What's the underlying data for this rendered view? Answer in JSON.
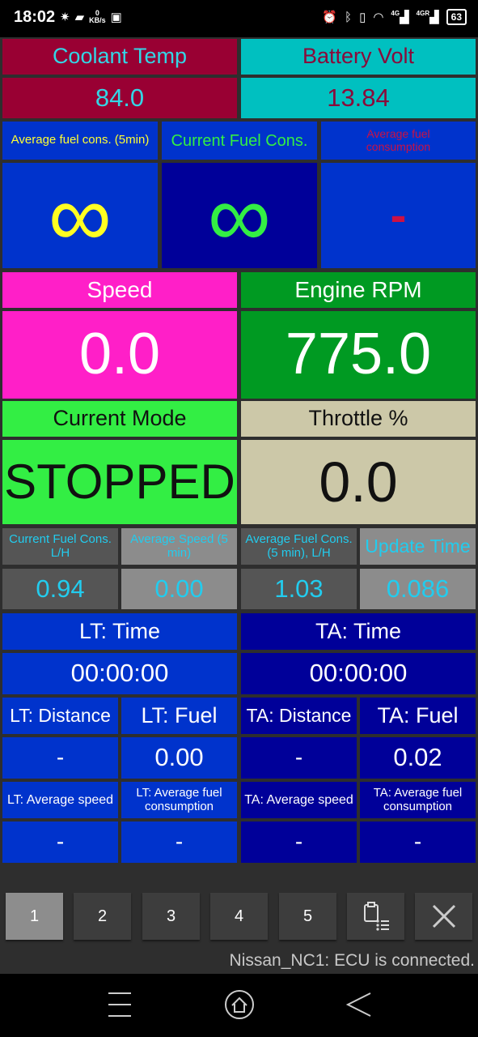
{
  "status_bar": {
    "time": "18:02",
    "net_speed_value": "0",
    "net_speed_unit": "KB/s",
    "signal1_label": "4G",
    "signal2_label": "4GR",
    "battery": "63"
  },
  "colors": {
    "maroon": "#990033",
    "cyan": "#00c0c0",
    "blue": "#0033cc",
    "navy": "#000099",
    "magenta": "#ff1fc8",
    "green": "#009a22",
    "lime": "#33ee44",
    "tan": "#ccc8a8",
    "dark_gray": "#555555",
    "mid_gray": "#8c8c8c"
  },
  "coolant": {
    "label": "Coolant Temp",
    "value": "84.0"
  },
  "battery_volt": {
    "label": "Battery Volt",
    "value": "13.84"
  },
  "avg_fuel_5min": {
    "label": "Average fuel cons. (5min)",
    "value": "∞"
  },
  "current_fuel": {
    "label": "Current Fuel Cons.",
    "value": "∞"
  },
  "avg_fuel": {
    "label": "Average fuel consumption",
    "value": "-"
  },
  "speed": {
    "label": "Speed",
    "value": "0.0"
  },
  "rpm": {
    "label": "Engine RPM",
    "value": "775.0"
  },
  "mode": {
    "label": "Current Mode",
    "value": "STOPPED"
  },
  "throttle": {
    "label": "Throttle %",
    "value": "0.0"
  },
  "small_stats": [
    {
      "label": "Current Fuel Cons. L/H",
      "value": "0.94"
    },
    {
      "label": "Average Speed (5 min)",
      "value": "0.00"
    },
    {
      "label": "Average Fuel Cons. (5 min), L/H",
      "value": "1.03"
    },
    {
      "label": "Update Time",
      "value": "0.086"
    }
  ],
  "lt_time": {
    "label": "LT: Time",
    "value": "00:00:00"
  },
  "ta_time": {
    "label": "TA: Time",
    "value": "00:00:00"
  },
  "lt_distance": {
    "label": "LT: Distance",
    "value": "-"
  },
  "lt_fuel": {
    "label": "LT: Fuel",
    "value": "0.00"
  },
  "ta_distance": {
    "label": "TA: Distance",
    "value": "-"
  },
  "ta_fuel": {
    "label": "TA: Fuel",
    "value": "0.02"
  },
  "lt_avg_speed": {
    "label": "LT: Average speed",
    "value": "-"
  },
  "lt_avg_fuel": {
    "label": "LT: Average fuel consumption",
    "value": "-"
  },
  "ta_avg_speed": {
    "label": "TA: Average speed",
    "value": "-"
  },
  "ta_avg_fuel": {
    "label": "TA: Average fuel consumption",
    "value": "-"
  },
  "pages": [
    "1",
    "2",
    "3",
    "4",
    "5"
  ],
  "active_page": "1",
  "connection_status": "Nissan_NC1: ECU is connected.",
  "icons": {
    "logs": "clipboard-list-icon",
    "close": "close-icon",
    "nav_menu": "menu-icon",
    "nav_home": "home-icon",
    "nav_back": "back-icon"
  }
}
